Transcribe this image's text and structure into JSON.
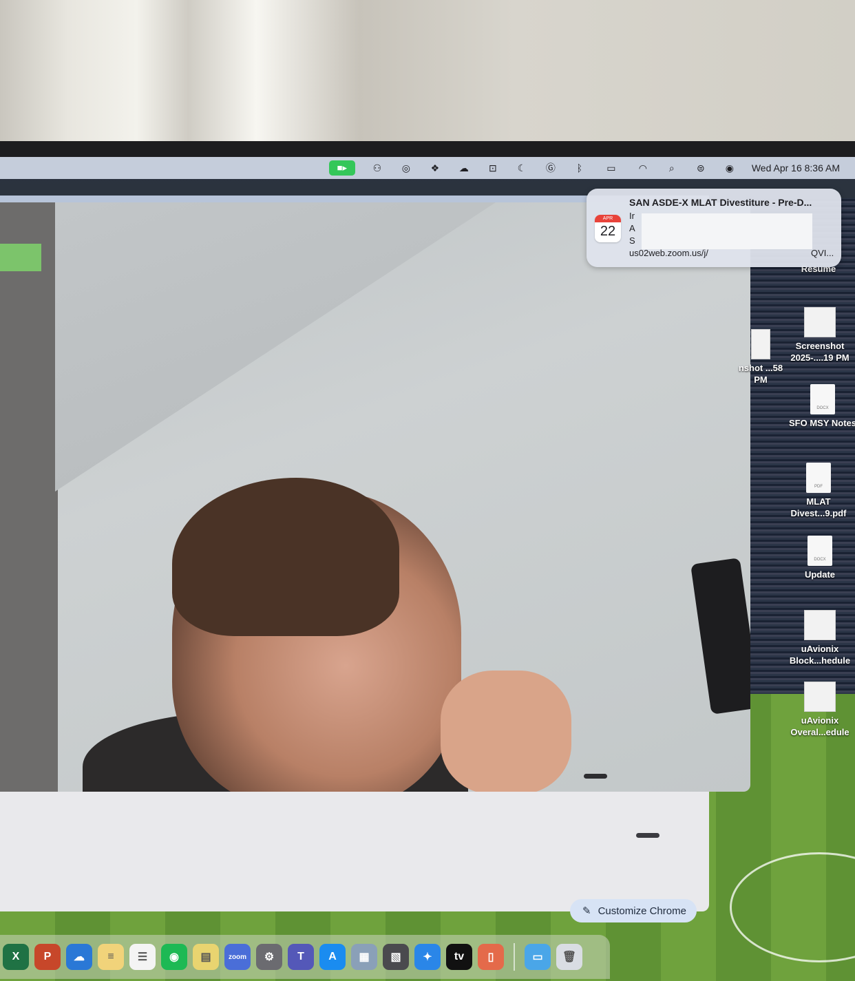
{
  "menubar": {
    "datetime": "Wed Apr 16  8:36 AM",
    "icons": [
      "camera-icon",
      "teams-icon",
      "creative-cloud-icon",
      "dropbox-icon",
      "icloud-icon",
      "outlook-icon",
      "moon-icon",
      "grammarly-icon",
      "bluetooth-icon",
      "battery-icon",
      "wifi-icon",
      "search-icon",
      "control-center-icon",
      "siri-icon"
    ]
  },
  "notification": {
    "app_icon": "calendar-icon",
    "cal_month": "APR",
    "cal_day": "22",
    "title": "SAN ASDE-X MLAT Divestiture - Pre-D...",
    "line1": "Ir",
    "line2": "A",
    "line3": "S",
    "line4": "us02web.zoom.us/j/",
    "line4_tail": "QVI..."
  },
  "desktop_icons": [
    {
      "label": "Resume",
      "kind": "doc"
    },
    {
      "label": "Screenshot 2025-....19 PM",
      "kind": "thumb"
    },
    {
      "label": "nshot ...58 PM",
      "kind": "thumb"
    },
    {
      "label": "SFO MSY Notes",
      "kind": "docx"
    },
    {
      "label": "MLAT Divest...9.pdf",
      "kind": "pdf"
    },
    {
      "label": "Update",
      "kind": "docx"
    },
    {
      "label": "uAvionix Block...hedule",
      "kind": "thumb"
    },
    {
      "label": "uAvionix Overal...edule",
      "kind": "thumb"
    }
  ],
  "browser": {
    "customize_label": "Customize Chrome"
  },
  "dock": {
    "apps": [
      {
        "name": "excel-icon",
        "glyph": "X",
        "color": "#1f7244"
      },
      {
        "name": "powerpoint-icon",
        "glyph": "P",
        "color": "#c7472a"
      },
      {
        "name": "onedrive-icon",
        "glyph": "☁",
        "color": "#2a78d6"
      },
      {
        "name": "notes-icon",
        "glyph": "≡",
        "color": "#f1d37a"
      },
      {
        "name": "reminders-icon",
        "glyph": "☰",
        "color": "#f4f4f4"
      },
      {
        "name": "spotify-icon",
        "glyph": "◉",
        "color": "#1db954"
      },
      {
        "name": "stickies-icon",
        "glyph": "▤",
        "color": "#e8d470"
      },
      {
        "name": "zoom-icon",
        "glyph": "zoom",
        "color": "#4a6ed8"
      },
      {
        "name": "system-settings-icon",
        "glyph": "⚙",
        "color": "#6b6b70"
      },
      {
        "name": "teams-icon",
        "glyph": "T",
        "color": "#5458b8"
      },
      {
        "name": "app-store-icon",
        "glyph": "A",
        "color": "#1a8cf0"
      },
      {
        "name": "preview-icon",
        "glyph": "▦",
        "color": "#8aa0b8"
      },
      {
        "name": "photo-booth-icon",
        "glyph": "▧",
        "color": "#4a4a4e"
      },
      {
        "name": "safari-icon",
        "glyph": "✦",
        "color": "#2a86e8"
      },
      {
        "name": "apple-tv-icon",
        "glyph": "tv",
        "color": "#111111"
      },
      {
        "name": "iphone-mirroring-icon",
        "glyph": "▯",
        "color": "#e46a4a"
      },
      {
        "name": "folder-icon",
        "glyph": "▭",
        "color": "#4aa6e8"
      },
      {
        "name": "trash-icon",
        "glyph": "🗑",
        "color": "#d9dde3"
      }
    ]
  }
}
